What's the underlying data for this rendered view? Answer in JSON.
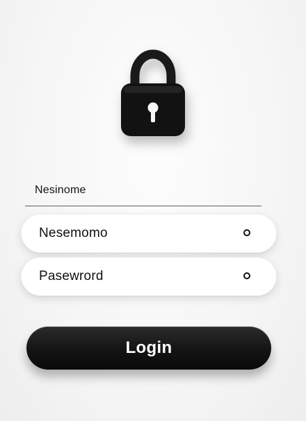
{
  "form": {
    "label": "Nesinome",
    "username_text": "Nesemomo",
    "password_text": "Pasewrord",
    "login_label": "Login"
  },
  "icons": {
    "lock": "lock-icon",
    "username_field_icon": "ring-icon",
    "password_field_icon": "ring-icon"
  },
  "colors": {
    "background": "#f6f6f6",
    "primary": "#111111",
    "button_text": "#ffffff"
  }
}
